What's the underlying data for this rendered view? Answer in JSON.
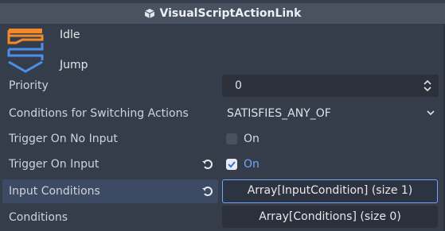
{
  "header": {
    "title": "VisualScriptActionLink",
    "icon": "node-cube-icon"
  },
  "link": {
    "from_label": "Idle",
    "to_label": "Jump",
    "icon": "action-link-icon",
    "colors": {
      "from": "#f08a2c",
      "to": "#4b8fea"
    }
  },
  "properties": {
    "priority": {
      "label": "Priority",
      "value": "0"
    },
    "switching": {
      "label": "Conditions for Switching Actions",
      "value": "SATISFIES_ANY_OF"
    },
    "trigger_no_input": {
      "label": "Trigger On No Input",
      "checked": false,
      "value_label": "On"
    },
    "trigger_input": {
      "label": "Trigger On Input",
      "checked": true,
      "value_label": "On"
    },
    "input_conditions": {
      "label": "Input Conditions",
      "value": "Array[InputCondition] (size 1)"
    },
    "conditions": {
      "label": "Conditions",
      "value": "Array[Conditions] (size 0)"
    }
  },
  "colors": {
    "background": "#363d4a",
    "field": "#2b303b",
    "accent": "#6fa5ff",
    "highlight_row": "#3c4a63"
  }
}
